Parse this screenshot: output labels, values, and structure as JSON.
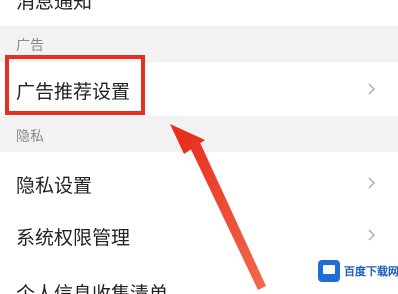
{
  "top_partial": {
    "label": "消息通知"
  },
  "sections": {
    "ad": {
      "header": "广告"
    },
    "privacy": {
      "header": "隐私"
    }
  },
  "rows": {
    "ad_settings": {
      "label": "广告推荐设置",
      "chevron": "chevron-right-icon"
    },
    "privacy_settings": {
      "label": "隐私设置",
      "chevron": "chevron-right-icon"
    },
    "permission_management": {
      "label": "系统权限管理",
      "chevron": "chevron-right-icon"
    },
    "personal_info_list": {
      "label": "个人信息收集清单"
    }
  },
  "annotation": {
    "highlight_color": "#e8301f",
    "arrow_color": "#e8301f"
  },
  "watermark": {
    "text": "百度下载网",
    "logo": "monitor-logo"
  },
  "colors": {
    "section_bg": "#f2f2f2",
    "text": "#222222",
    "muted": "#8a8a8a"
  }
}
